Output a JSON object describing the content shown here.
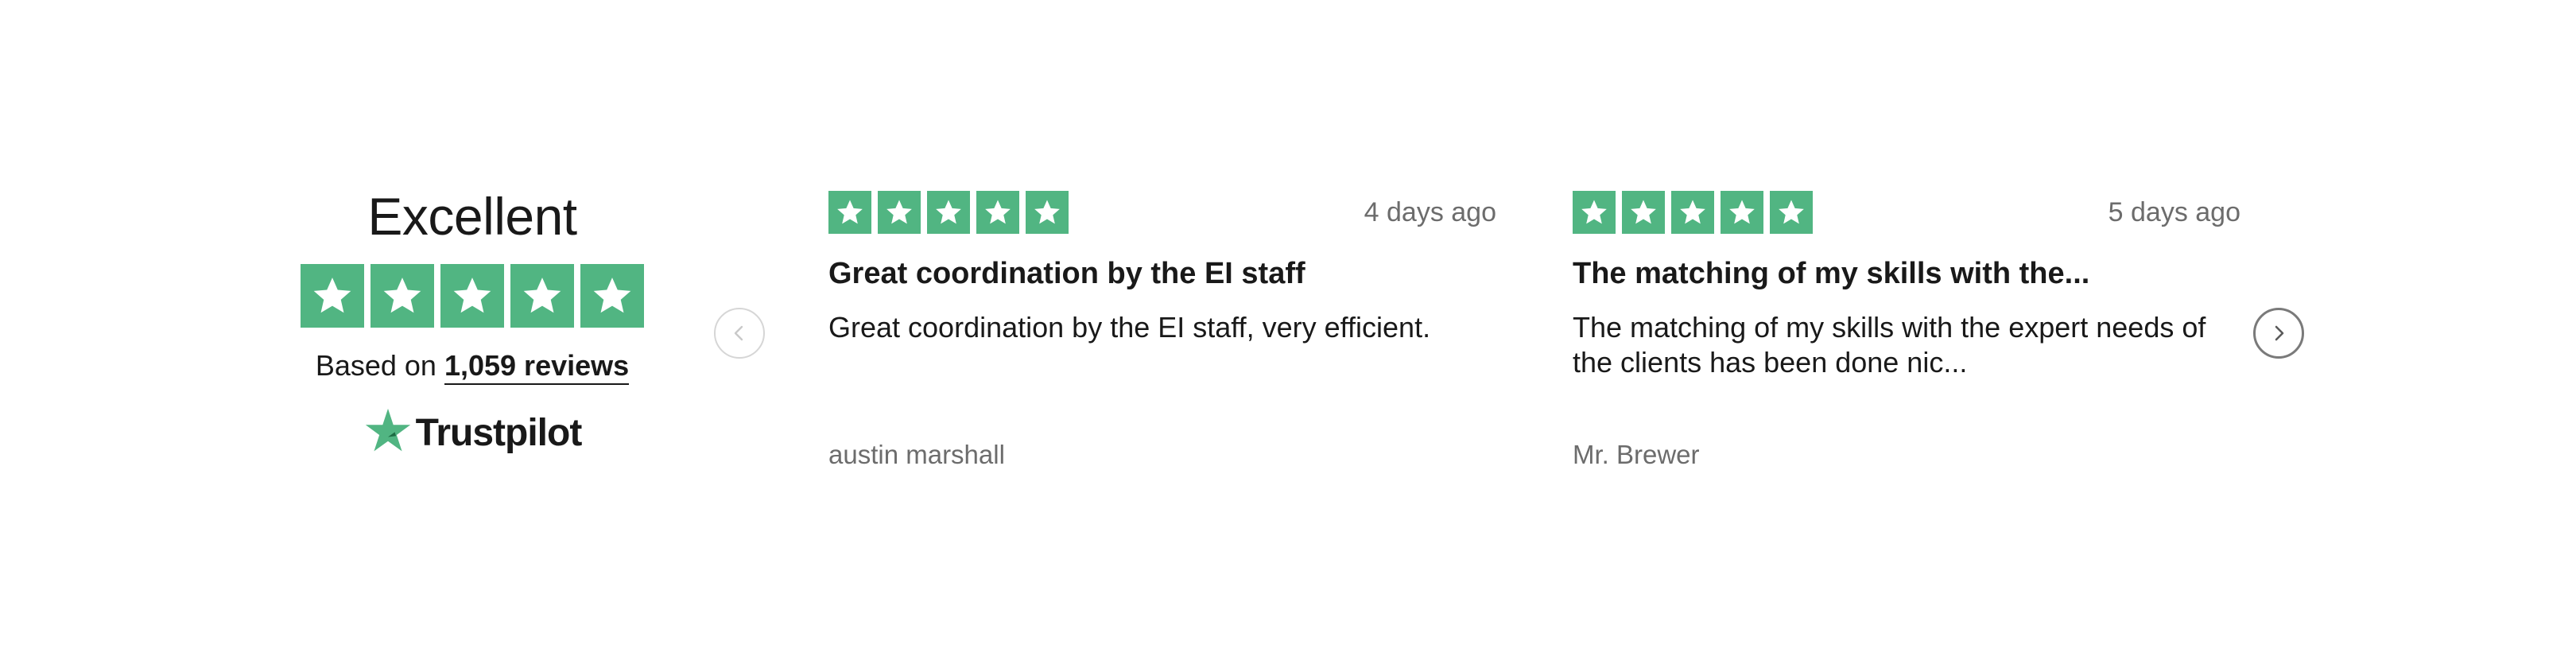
{
  "colors": {
    "star_green": "#51b582",
    "text_primary": "#191919",
    "text_muted": "#6c6c6c",
    "arrow_prev_border": "#d6d6d6",
    "arrow_next_border": "#7a7a7a"
  },
  "summary": {
    "title": "Excellent",
    "rating_stars": 5,
    "based_on_prefix": "Based on",
    "review_count_label": "1,059 reviews",
    "brand_name": "Trustpilot",
    "brand_icon": "trustpilot-star-icon"
  },
  "carousel": {
    "prev_icon": "chevron-left-icon",
    "next_icon": "chevron-right-icon",
    "reviews": [
      {
        "stars": 5,
        "date": "4 days ago",
        "title": "Great coordination by the EI staff",
        "body": "Great coordination by the EI staff, very efficient.",
        "author": "austin marshall"
      },
      {
        "stars": 5,
        "date": "5 days ago",
        "title": "The matching of my skills with the...",
        "body": "The matching of my skills with the expert needs of the clients has been done nic...",
        "author": "Mr. Brewer"
      }
    ]
  }
}
